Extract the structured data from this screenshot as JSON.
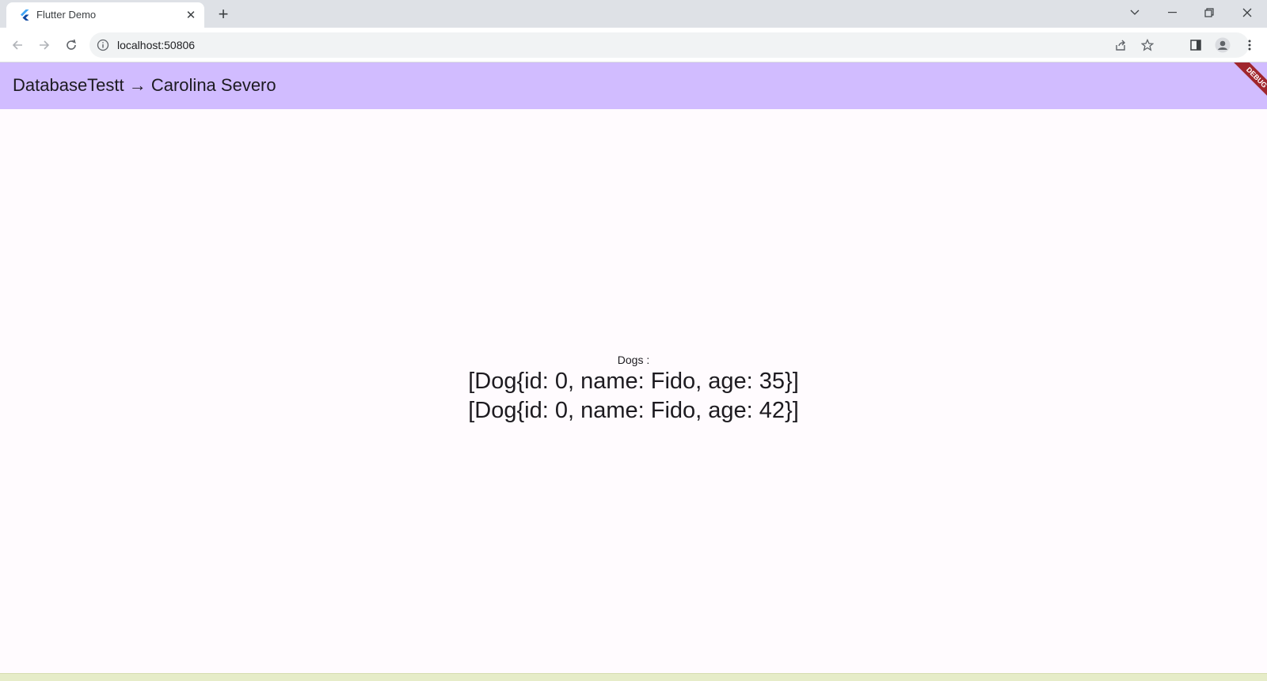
{
  "browser": {
    "tab": {
      "title": "Flutter Demo",
      "favicon": "flutter-logo-icon"
    },
    "address_bar": {
      "url": "localhost:50806"
    },
    "icons": {
      "back": "back-arrow-icon",
      "forward": "forward-arrow-icon",
      "reload": "reload-icon",
      "info": "info-icon",
      "share": "share-icon",
      "bookmark": "star-icon",
      "side_panel": "side-panel-icon",
      "profile": "profile-icon",
      "menu": "kebab-menu-icon"
    }
  },
  "app": {
    "appbar": {
      "title": "DatabaseTestt → Carolina Severo",
      "color": "#d1bcff"
    },
    "debug_banner": "DEBUG",
    "content": {
      "label": "Dogs :",
      "lines": [
        "[Dog{id: 0, name: Fido, age: 35}]",
        "[Dog{id: 0, name: Fido, age: 42}]"
      ]
    }
  },
  "colors": {
    "background": "#fffbfe",
    "debug_ribbon": "#a0262d",
    "tabstrip": "#dee1e6"
  }
}
